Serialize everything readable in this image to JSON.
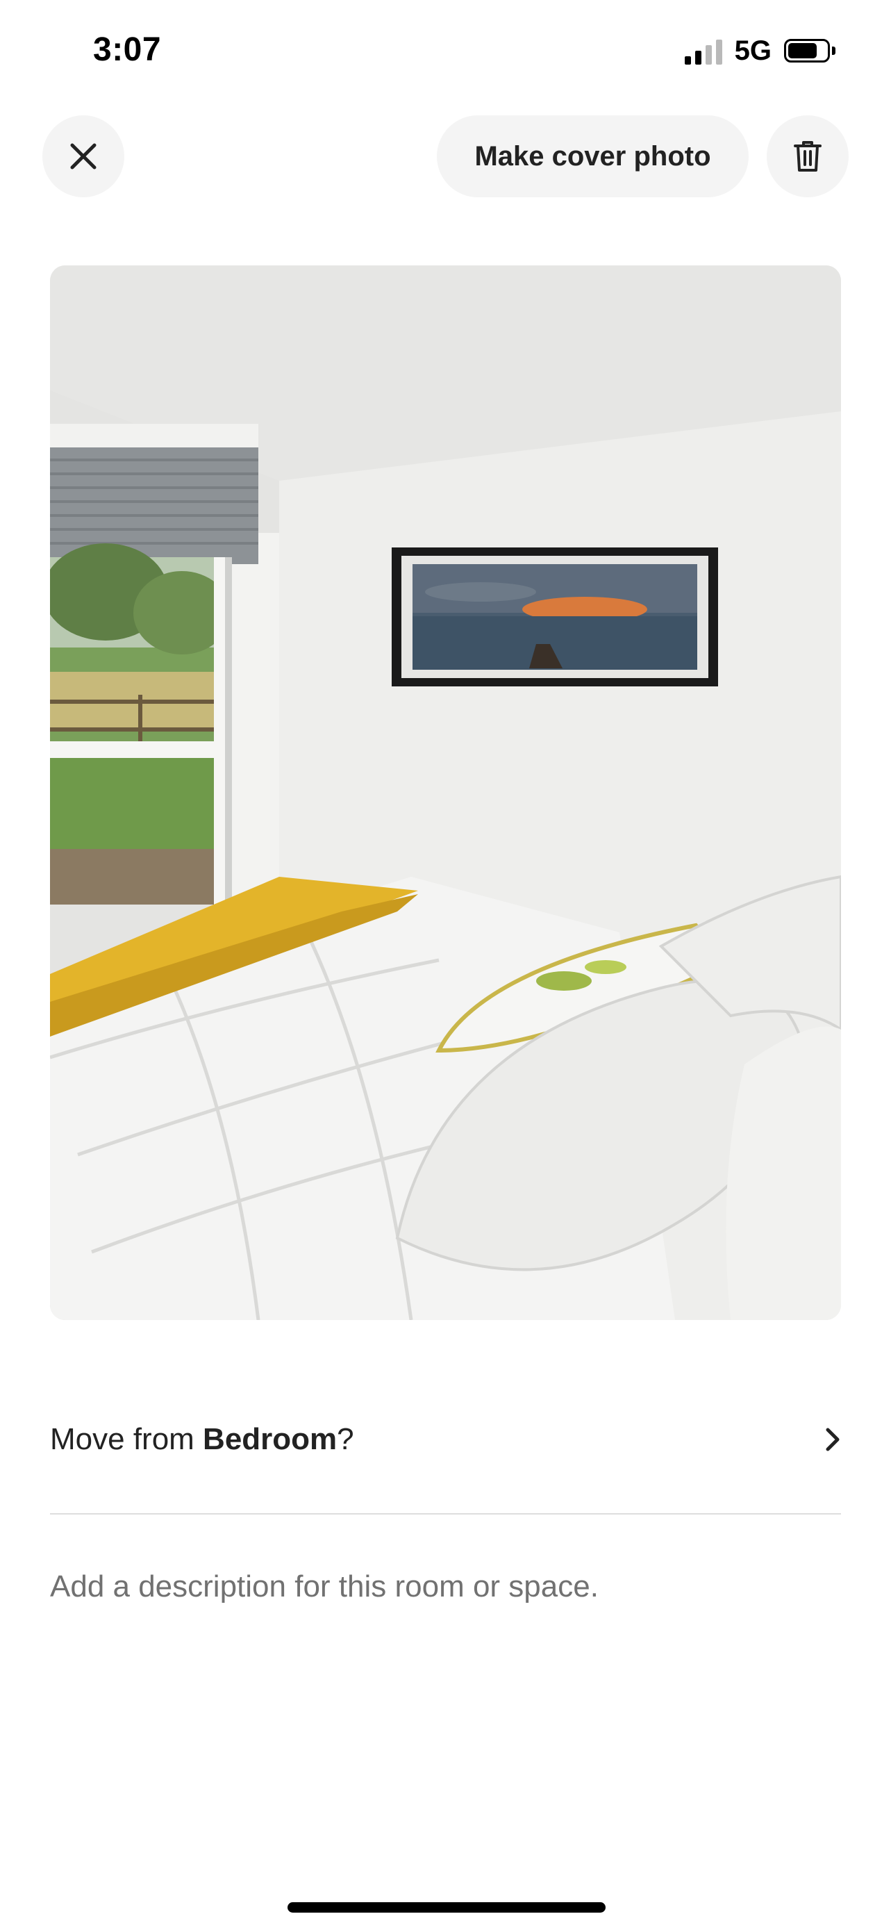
{
  "status_bar": {
    "time": "3:07",
    "network": "5G",
    "signal_bars_active": 2,
    "signal_bars_total": 4,
    "battery_level": 0.75
  },
  "toolbar": {
    "close_icon": "close-icon",
    "cover_label": "Make cover photo",
    "delete_icon": "trash-icon"
  },
  "photo": {
    "subject": "bedroom"
  },
  "room": {
    "prefix": "Move from ",
    "name": "Bedroom",
    "suffix": "?",
    "chevron_icon": "chevron-right-icon"
  },
  "description": {
    "placeholder": "Add a description for this room or space."
  },
  "colors": {
    "button_bg": "#f4f4f4",
    "text_primary": "#222222",
    "text_secondary": "#717171",
    "divider": "#dddddd"
  }
}
